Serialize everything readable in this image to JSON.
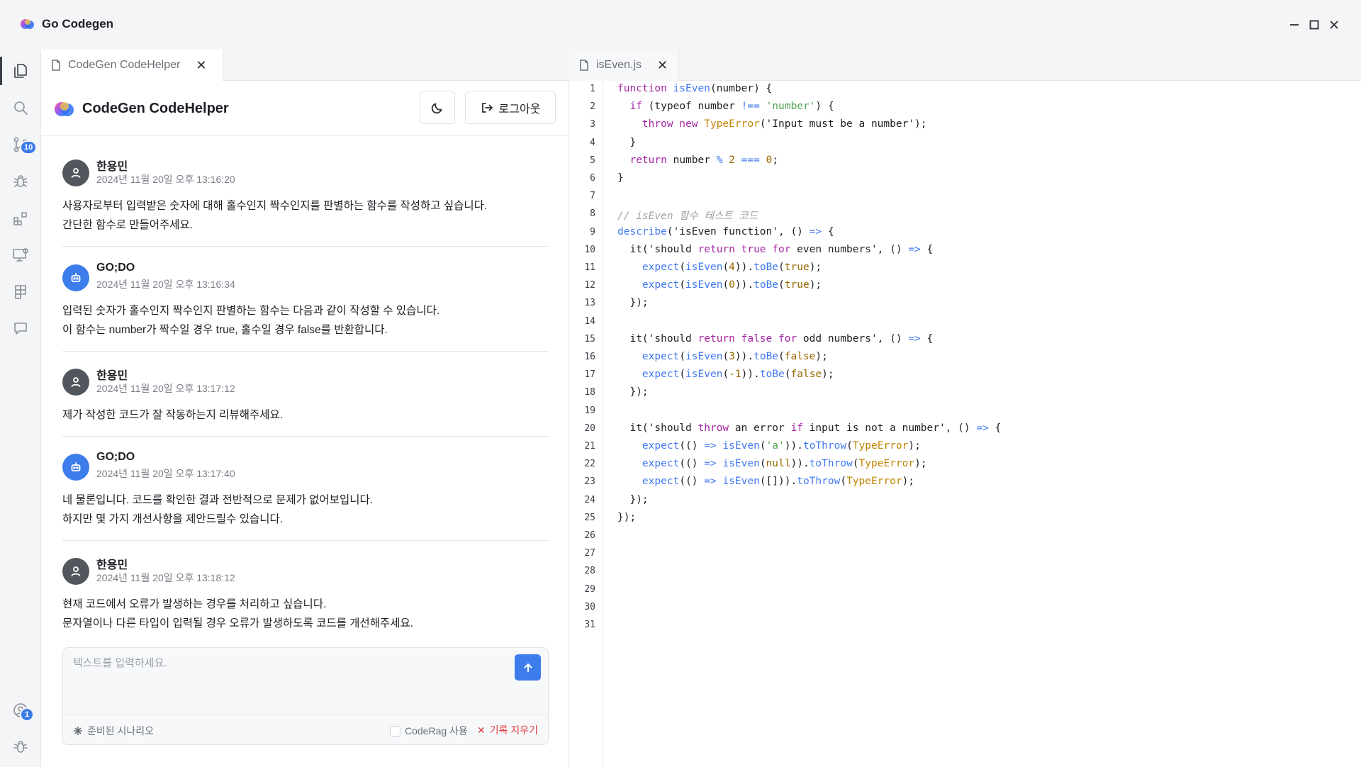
{
  "app": {
    "title": "Go Codegen"
  },
  "activity_bar": {
    "items": [
      {
        "icon": "files-icon",
        "active": true
      },
      {
        "icon": "search-icon"
      },
      {
        "icon": "source-control-icon",
        "badge": "10"
      },
      {
        "icon": "debug-icon"
      },
      {
        "icon": "extensions-icon"
      },
      {
        "icon": "remote-explorer-icon"
      },
      {
        "icon": "layers-icon"
      },
      {
        "icon": "comment-icon"
      }
    ],
    "bottom": [
      {
        "icon": "account-icon",
        "badge": "1"
      },
      {
        "icon": "settings-icon"
      }
    ]
  },
  "chat": {
    "tab_label": "CodeGen CodeHelper",
    "header_title": "CodeGen CodeHelper",
    "logout_label": "로그아웃",
    "messages": [
      {
        "role": "user",
        "name": "한용민",
        "time": "2024년 11월 20일 오후 13:16:20",
        "lines": [
          "사용자로부터 입력받은 숫자에 대해 홀수인지 짝수인지를 판별하는 함수를 작성하고 싶습니다.",
          "간단한 함수로 만들어주세요."
        ]
      },
      {
        "role": "bot",
        "name": "GO;DO",
        "time": "2024년 11월 20일 오후 13:16:34",
        "lines": [
          "입력된 숫자가 홀수인지 짝수인지 판별하는 함수는 다음과 같이 작성할 수 있습니다.",
          "이 함수는 number가 짝수일 경우 true, 홀수일 경우 false를 반환합니다."
        ]
      },
      {
        "role": "user",
        "name": "한용민",
        "time": "2024년 11월 20일 오후 13:17:12",
        "lines": [
          "제가 작성한 코드가 잘 작동하는지 리뷰해주세요."
        ]
      },
      {
        "role": "bot",
        "name": "GO;DO",
        "time": "2024년 11월 20일 오후 13:17:40",
        "lines": [
          "네 물론입니다. 코드를 확인한 결과 전반적으로 문제가 없어보입니다.",
          "하지만 몇 가지 개선사항을 제안드릴수 있습니다."
        ]
      },
      {
        "role": "user",
        "name": "한용민",
        "time": "2024년 11월 20일 오후 13:18:12",
        "lines": [
          "현재 코드에서 오류가 발생하는 경우를 처리하고 싶습니다.",
          "문자열이나 다른 타입이 입력될 경우 오류가 발생하도록 코드를 개선해주세요."
        ]
      }
    ],
    "composer": {
      "placeholder": "텍스트를 입력하세요.",
      "value": "",
      "scenario_label": "준비된 시나리오",
      "coderag_label": "CodeRag 사용",
      "clear_label": "기록 지우기"
    }
  },
  "editor": {
    "tab_label": "isEven.js",
    "lines": [
      [
        [
          "kw",
          "function "
        ],
        [
          "fn",
          "isEven"
        ],
        [
          "pl",
          "(number) {"
        ]
      ],
      [
        [
          "pl",
          "  "
        ],
        [
          "kw",
          "if"
        ],
        [
          "pl",
          " (typeof number "
        ],
        [
          "op",
          "!=="
        ],
        [
          "pl",
          " "
        ],
        [
          "str",
          "'number'"
        ],
        [
          "pl",
          ") {"
        ]
      ],
      [
        [
          "pl",
          "    "
        ],
        [
          "kw",
          "throw new "
        ],
        [
          "ty",
          "TypeError"
        ],
        [
          "pl",
          "('Input must be a number');"
        ]
      ],
      [
        [
          "pl",
          "  }"
        ]
      ],
      [
        [
          "pl",
          "  "
        ],
        [
          "kw",
          "return"
        ],
        [
          "pl",
          " number "
        ],
        [
          "op",
          "%"
        ],
        [
          "pl",
          " "
        ],
        [
          "num",
          "2"
        ],
        [
          "pl",
          " "
        ],
        [
          "op",
          "==="
        ],
        [
          "pl",
          " "
        ],
        [
          "num",
          "0"
        ],
        [
          "pl",
          ";"
        ]
      ],
      [
        [
          "pl",
          "}"
        ]
      ],
      [],
      [
        [
          "cm",
          "// isEven 함수 테스트 코드"
        ]
      ],
      [
        [
          "fn",
          "describe"
        ],
        [
          "pl",
          "('isEven function', () "
        ],
        [
          "op",
          "=>"
        ],
        [
          "pl",
          " {"
        ]
      ],
      [
        [
          "pl",
          "  it('should "
        ],
        [
          "kw",
          "return true for"
        ],
        [
          "pl",
          " even numbers', () "
        ],
        [
          "op",
          "=>"
        ],
        [
          "pl",
          " {"
        ]
      ],
      [
        [
          "pl",
          "    "
        ],
        [
          "fn",
          "expect"
        ],
        [
          "pl",
          "("
        ],
        [
          "fn",
          "isEven"
        ],
        [
          "pl",
          "("
        ],
        [
          "num",
          "4"
        ],
        [
          "pl",
          "))."
        ],
        [
          "fn",
          "toBe"
        ],
        [
          "pl",
          "("
        ],
        [
          "num",
          "true"
        ],
        [
          "pl",
          ");"
        ]
      ],
      [
        [
          "pl",
          "    "
        ],
        [
          "fn",
          "expect"
        ],
        [
          "pl",
          "("
        ],
        [
          "fn",
          "isEven"
        ],
        [
          "pl",
          "("
        ],
        [
          "num",
          "0"
        ],
        [
          "pl",
          "))."
        ],
        [
          "fn",
          "toBe"
        ],
        [
          "pl",
          "("
        ],
        [
          "num",
          "true"
        ],
        [
          "pl",
          ");"
        ]
      ],
      [
        [
          "pl",
          "  });"
        ]
      ],
      [],
      [
        [
          "pl",
          "  it('should "
        ],
        [
          "kw",
          "return false for"
        ],
        [
          "pl",
          " odd numbers', () "
        ],
        [
          "op",
          "=>"
        ],
        [
          "pl",
          " {"
        ]
      ],
      [
        [
          "pl",
          "    "
        ],
        [
          "fn",
          "expect"
        ],
        [
          "pl",
          "("
        ],
        [
          "fn",
          "isEven"
        ],
        [
          "pl",
          "("
        ],
        [
          "num",
          "3"
        ],
        [
          "pl",
          "))."
        ],
        [
          "fn",
          "toBe"
        ],
        [
          "pl",
          "("
        ],
        [
          "num",
          "false"
        ],
        [
          "pl",
          ");"
        ]
      ],
      [
        [
          "pl",
          "    "
        ],
        [
          "fn",
          "expect"
        ],
        [
          "pl",
          "("
        ],
        [
          "fn",
          "isEven"
        ],
        [
          "pl",
          "("
        ],
        [
          "num",
          "-1"
        ],
        [
          "pl",
          "))."
        ],
        [
          "fn",
          "toBe"
        ],
        [
          "pl",
          "("
        ],
        [
          "num",
          "false"
        ],
        [
          "pl",
          ");"
        ]
      ],
      [
        [
          "pl",
          "  });"
        ]
      ],
      [],
      [
        [
          "pl",
          "  it('should "
        ],
        [
          "kw",
          "throw"
        ],
        [
          "pl",
          " an error "
        ],
        [
          "kw",
          "if"
        ],
        [
          "pl",
          " input is not a number', () "
        ],
        [
          "op",
          "=>"
        ],
        [
          "pl",
          " {"
        ]
      ],
      [
        [
          "pl",
          "    "
        ],
        [
          "fn",
          "expect"
        ],
        [
          "pl",
          "(() "
        ],
        [
          "op",
          "=>"
        ],
        [
          "pl",
          " "
        ],
        [
          "fn",
          "isEven"
        ],
        [
          "pl",
          "("
        ],
        [
          "str",
          "'a'"
        ],
        [
          "pl",
          "))."
        ],
        [
          "fn",
          "toThrow"
        ],
        [
          "pl",
          "("
        ],
        [
          "ty",
          "TypeError"
        ],
        [
          "pl",
          ");"
        ]
      ],
      [
        [
          "pl",
          "    "
        ],
        [
          "fn",
          "expect"
        ],
        [
          "pl",
          "(() "
        ],
        [
          "op",
          "=>"
        ],
        [
          "pl",
          " "
        ],
        [
          "fn",
          "isEven"
        ],
        [
          "pl",
          "("
        ],
        [
          "num",
          "null"
        ],
        [
          "pl",
          "))."
        ],
        [
          "fn",
          "toThrow"
        ],
        [
          "pl",
          "("
        ],
        [
          "ty",
          "TypeError"
        ],
        [
          "pl",
          ");"
        ]
      ],
      [
        [
          "pl",
          "    "
        ],
        [
          "fn",
          "expect"
        ],
        [
          "pl",
          "(() "
        ],
        [
          "op",
          "=>"
        ],
        [
          "pl",
          " "
        ],
        [
          "fn",
          "isEven"
        ],
        [
          "pl",
          "([]))."
        ],
        [
          "fn",
          "toThrow"
        ],
        [
          "pl",
          "("
        ],
        [
          "ty",
          "TypeError"
        ],
        [
          "pl",
          ");"
        ]
      ],
      [
        [
          "pl",
          "  });"
        ]
      ],
      [
        [
          "pl",
          "});"
        ]
      ],
      [],
      [],
      [],
      [],
      [],
      []
    ]
  }
}
